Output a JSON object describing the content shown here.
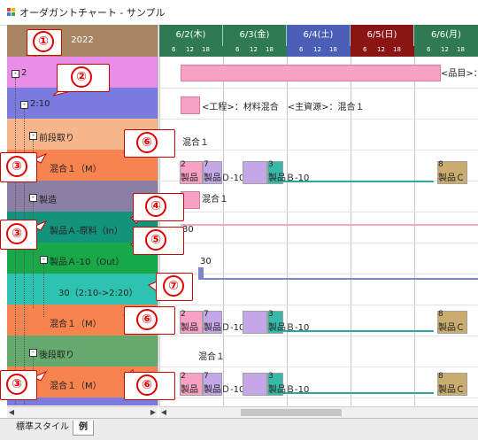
{
  "window": {
    "title": "オーダガントチャート - サンプル"
  },
  "left": {
    "year": "2022",
    "rows": [
      {
        "label": "2",
        "color": "#e98de9"
      },
      {
        "label": "2:10",
        "color": "#7b7bdf"
      },
      {
        "label": "前段取り",
        "color": "#f6b58a"
      },
      {
        "label": "混合１（M）",
        "color": "#f7834f"
      },
      {
        "label": "製造",
        "color": "#8c7fa5"
      },
      {
        "label": "製品Ａ-原料（In）",
        "color": "#14937c"
      },
      {
        "label": "製品Ａ-10（Out）",
        "color": "#18a848"
      },
      {
        "label": "30（2:10->2:20）",
        "color": "#2ec3b0"
      },
      {
        "label": "混合１（M）",
        "color": "#f7834f"
      },
      {
        "label": "後段取り",
        "color": "#65a96f"
      },
      {
        "label": "混合１（M）",
        "color": "#f7834f"
      }
    ]
  },
  "timeline": {
    "days": [
      {
        "label": "6/2(木)",
        "color": "#2f7a52"
      },
      {
        "label": "6/3(金)",
        "color": "#2f7a52"
      },
      {
        "label": "6/4(土)",
        "color": "#4a5fb5"
      },
      {
        "label": "6/5(日)",
        "color": "#8b1414"
      },
      {
        "label": "6/6(月)",
        "color": "#2f7a52"
      }
    ],
    "ticks": [
      "6",
      "12",
      "18"
    ]
  },
  "gantt": {
    "row0_label": "<品目>：",
    "row1_label": "<工程>：材料混合　<主資源>：混合１",
    "row2_label": "混合１",
    "row4_label": "混合１",
    "row5_value": "30",
    "row6_value": "30",
    "row9_label": "混合１",
    "op_tags": [
      "2",
      "7",
      "3",
      "8"
    ],
    "op_names": [
      "製品",
      "製品Ｄ-10",
      "製品Ｂ-10",
      "製品Ｃ"
    ]
  },
  "callouts": [
    "①",
    "②",
    "③",
    "④",
    "⑤",
    "⑥",
    "⑦"
  ],
  "tabs": {
    "style": "標準スタイル",
    "example": "例"
  },
  "colors": {
    "pink": "#f7a1c4",
    "purple": "#c4a7e7",
    "teal": "#37b8a8",
    "tan": "#c9ac6e",
    "slate": "#7d86c8"
  }
}
